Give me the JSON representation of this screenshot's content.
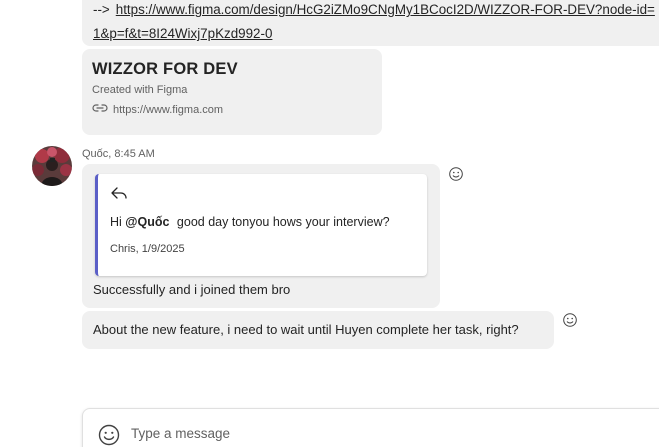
{
  "messages": {
    "link_message": {
      "prefix": "-->",
      "url_line1": "https://www.figma.com/design/HcG2iZMo9CNgMy1BCocI2D/WIZZOR-FOR-DEV?node-id=",
      "url_line2": "1&p=f&t=8I24Wixj7pKzd992-0",
      "preview": {
        "title": "WIZZOR FOR DEV",
        "subtitle": "Created with Figma",
        "url": "https://www.figma.com"
      }
    },
    "sender": {
      "name_time": "Quốc, 8:45 AM"
    },
    "reply_message": {
      "quote": {
        "greeting": "Hi",
        "mention": "@Quốc",
        "text": "good day tonyou hows your interview?",
        "sender_date": "Chris, 1/9/2025"
      },
      "text": "Successfully and i joined them bro"
    },
    "followup_message": {
      "text": "About the new feature, i need to wait until Huyen complete her task, right?"
    }
  },
  "compose": {
    "placeholder": "Type a message"
  },
  "colors": {
    "bubble_bg": "#f0f0f0",
    "quote_accent": "#5b5fc7",
    "meta_text": "#616161"
  }
}
